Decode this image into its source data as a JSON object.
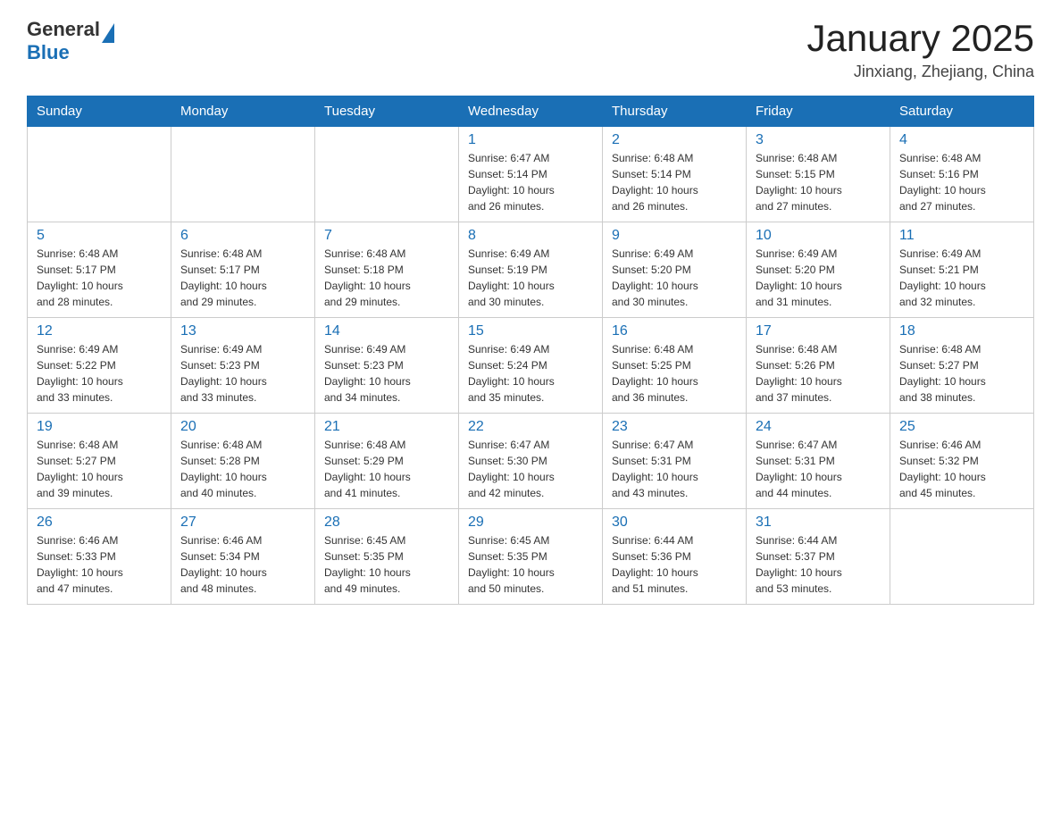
{
  "header": {
    "logo_general": "General",
    "logo_blue": "Blue",
    "month_title": "January 2025",
    "location": "Jinxiang, Zhejiang, China"
  },
  "days_of_week": [
    "Sunday",
    "Monday",
    "Tuesday",
    "Wednesday",
    "Thursday",
    "Friday",
    "Saturday"
  ],
  "weeks": [
    [
      {
        "day": "",
        "info": ""
      },
      {
        "day": "",
        "info": ""
      },
      {
        "day": "",
        "info": ""
      },
      {
        "day": "1",
        "info": "Sunrise: 6:47 AM\nSunset: 5:14 PM\nDaylight: 10 hours\nand 26 minutes."
      },
      {
        "day": "2",
        "info": "Sunrise: 6:48 AM\nSunset: 5:14 PM\nDaylight: 10 hours\nand 26 minutes."
      },
      {
        "day": "3",
        "info": "Sunrise: 6:48 AM\nSunset: 5:15 PM\nDaylight: 10 hours\nand 27 minutes."
      },
      {
        "day": "4",
        "info": "Sunrise: 6:48 AM\nSunset: 5:16 PM\nDaylight: 10 hours\nand 27 minutes."
      }
    ],
    [
      {
        "day": "5",
        "info": "Sunrise: 6:48 AM\nSunset: 5:17 PM\nDaylight: 10 hours\nand 28 minutes."
      },
      {
        "day": "6",
        "info": "Sunrise: 6:48 AM\nSunset: 5:17 PM\nDaylight: 10 hours\nand 29 minutes."
      },
      {
        "day": "7",
        "info": "Sunrise: 6:48 AM\nSunset: 5:18 PM\nDaylight: 10 hours\nand 29 minutes."
      },
      {
        "day": "8",
        "info": "Sunrise: 6:49 AM\nSunset: 5:19 PM\nDaylight: 10 hours\nand 30 minutes."
      },
      {
        "day": "9",
        "info": "Sunrise: 6:49 AM\nSunset: 5:20 PM\nDaylight: 10 hours\nand 30 minutes."
      },
      {
        "day": "10",
        "info": "Sunrise: 6:49 AM\nSunset: 5:20 PM\nDaylight: 10 hours\nand 31 minutes."
      },
      {
        "day": "11",
        "info": "Sunrise: 6:49 AM\nSunset: 5:21 PM\nDaylight: 10 hours\nand 32 minutes."
      }
    ],
    [
      {
        "day": "12",
        "info": "Sunrise: 6:49 AM\nSunset: 5:22 PM\nDaylight: 10 hours\nand 33 minutes."
      },
      {
        "day": "13",
        "info": "Sunrise: 6:49 AM\nSunset: 5:23 PM\nDaylight: 10 hours\nand 33 minutes."
      },
      {
        "day": "14",
        "info": "Sunrise: 6:49 AM\nSunset: 5:23 PM\nDaylight: 10 hours\nand 34 minutes."
      },
      {
        "day": "15",
        "info": "Sunrise: 6:49 AM\nSunset: 5:24 PM\nDaylight: 10 hours\nand 35 minutes."
      },
      {
        "day": "16",
        "info": "Sunrise: 6:48 AM\nSunset: 5:25 PM\nDaylight: 10 hours\nand 36 minutes."
      },
      {
        "day": "17",
        "info": "Sunrise: 6:48 AM\nSunset: 5:26 PM\nDaylight: 10 hours\nand 37 minutes."
      },
      {
        "day": "18",
        "info": "Sunrise: 6:48 AM\nSunset: 5:27 PM\nDaylight: 10 hours\nand 38 minutes."
      }
    ],
    [
      {
        "day": "19",
        "info": "Sunrise: 6:48 AM\nSunset: 5:27 PM\nDaylight: 10 hours\nand 39 minutes."
      },
      {
        "day": "20",
        "info": "Sunrise: 6:48 AM\nSunset: 5:28 PM\nDaylight: 10 hours\nand 40 minutes."
      },
      {
        "day": "21",
        "info": "Sunrise: 6:48 AM\nSunset: 5:29 PM\nDaylight: 10 hours\nand 41 minutes."
      },
      {
        "day": "22",
        "info": "Sunrise: 6:47 AM\nSunset: 5:30 PM\nDaylight: 10 hours\nand 42 minutes."
      },
      {
        "day": "23",
        "info": "Sunrise: 6:47 AM\nSunset: 5:31 PM\nDaylight: 10 hours\nand 43 minutes."
      },
      {
        "day": "24",
        "info": "Sunrise: 6:47 AM\nSunset: 5:31 PM\nDaylight: 10 hours\nand 44 minutes."
      },
      {
        "day": "25",
        "info": "Sunrise: 6:46 AM\nSunset: 5:32 PM\nDaylight: 10 hours\nand 45 minutes."
      }
    ],
    [
      {
        "day": "26",
        "info": "Sunrise: 6:46 AM\nSunset: 5:33 PM\nDaylight: 10 hours\nand 47 minutes."
      },
      {
        "day": "27",
        "info": "Sunrise: 6:46 AM\nSunset: 5:34 PM\nDaylight: 10 hours\nand 48 minutes."
      },
      {
        "day": "28",
        "info": "Sunrise: 6:45 AM\nSunset: 5:35 PM\nDaylight: 10 hours\nand 49 minutes."
      },
      {
        "day": "29",
        "info": "Sunrise: 6:45 AM\nSunset: 5:35 PM\nDaylight: 10 hours\nand 50 minutes."
      },
      {
        "day": "30",
        "info": "Sunrise: 6:44 AM\nSunset: 5:36 PM\nDaylight: 10 hours\nand 51 minutes."
      },
      {
        "day": "31",
        "info": "Sunrise: 6:44 AM\nSunset: 5:37 PM\nDaylight: 10 hours\nand 53 minutes."
      },
      {
        "day": "",
        "info": ""
      }
    ]
  ]
}
